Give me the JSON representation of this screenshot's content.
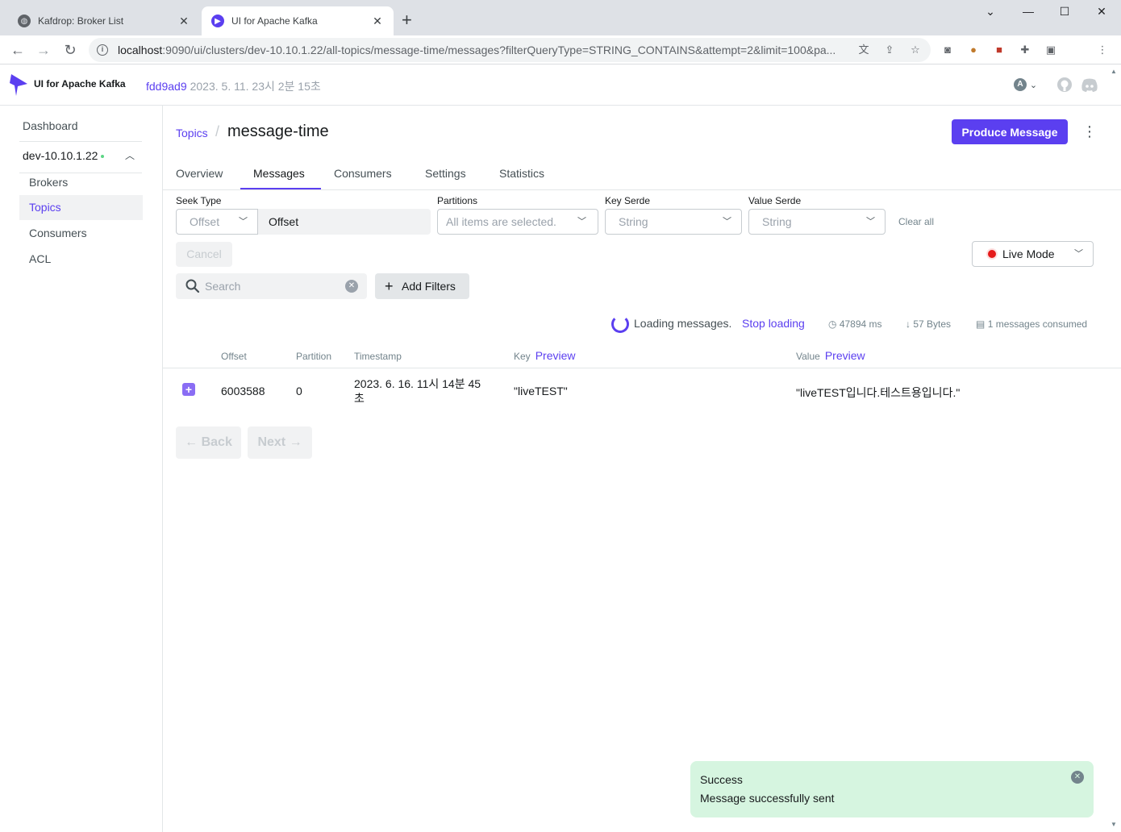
{
  "browser": {
    "tabs": [
      {
        "title": "Kafdrop: Broker List",
        "active": false
      },
      {
        "title": "UI for Apache Kafka",
        "active": true
      }
    ],
    "url_host": "localhost",
    "url_rest": ":9090/ui/clusters/dev-10.10.1.22/all-topics/message-time/messages?filterQueryType=STRING_CONTAINS&attempt=2&limit=100&pa..."
  },
  "header": {
    "app_name": "UI for Apache Kafka",
    "version_hash": "fdd9ad9",
    "version_date": "2023. 5. 11. 23시 2분 15초",
    "account_initial": "A"
  },
  "sidebar": {
    "dashboard": "Dashboard",
    "cluster": "dev-10.10.1.22",
    "items": [
      {
        "label": "Brokers",
        "active": false
      },
      {
        "label": "Topics",
        "active": true
      },
      {
        "label": "Consumers",
        "active": false
      },
      {
        "label": "ACL",
        "active": false
      }
    ]
  },
  "page": {
    "breadcrumb": "Topics",
    "title": "message-time",
    "produce_button": "Produce Message",
    "tabs": [
      "Overview",
      "Messages",
      "Consumers",
      "Settings",
      "Statistics"
    ]
  },
  "filters": {
    "seek_type_label": "Seek Type",
    "seek_type_value": "Offset",
    "seek_input_value": "Offset",
    "partitions_label": "Partitions",
    "partitions_value": "All items are selected.",
    "key_serde_label": "Key Serde",
    "key_serde_value": "String",
    "value_serde_label": "Value Serde",
    "value_serde_value": "String",
    "clear_all": "Clear all",
    "live_mode": "Live Mode",
    "cancel": "Cancel",
    "search_placeholder": "Search",
    "add_filters": "Add Filters"
  },
  "status": {
    "loading_text": "Loading messages.",
    "stop_loading": "Stop loading",
    "elapsed": "47894 ms",
    "bytes": "57 Bytes",
    "consumed": "1 messages consumed"
  },
  "table": {
    "headers": {
      "offset": "Offset",
      "partition": "Partition",
      "timestamp": "Timestamp",
      "key": "Key",
      "value": "Value",
      "preview": "Preview"
    },
    "rows": [
      {
        "offset": "6003588",
        "partition": "0",
        "timestamp_line1": "2023. 6. 16. 11시 14분 45",
        "timestamp_line2": "초",
        "key": "\"liveTEST\"",
        "value": "\"liveTEST입니다.테스트용입니다.\""
      }
    ]
  },
  "pagination": {
    "back": "← Back",
    "next": "Next →"
  },
  "toast": {
    "title": "Success",
    "message": "Message successfully sent"
  },
  "colors": {
    "accent": "#5b3ff0",
    "success_bg": "#d6f5e0",
    "live_dot": "#e51a1a"
  }
}
